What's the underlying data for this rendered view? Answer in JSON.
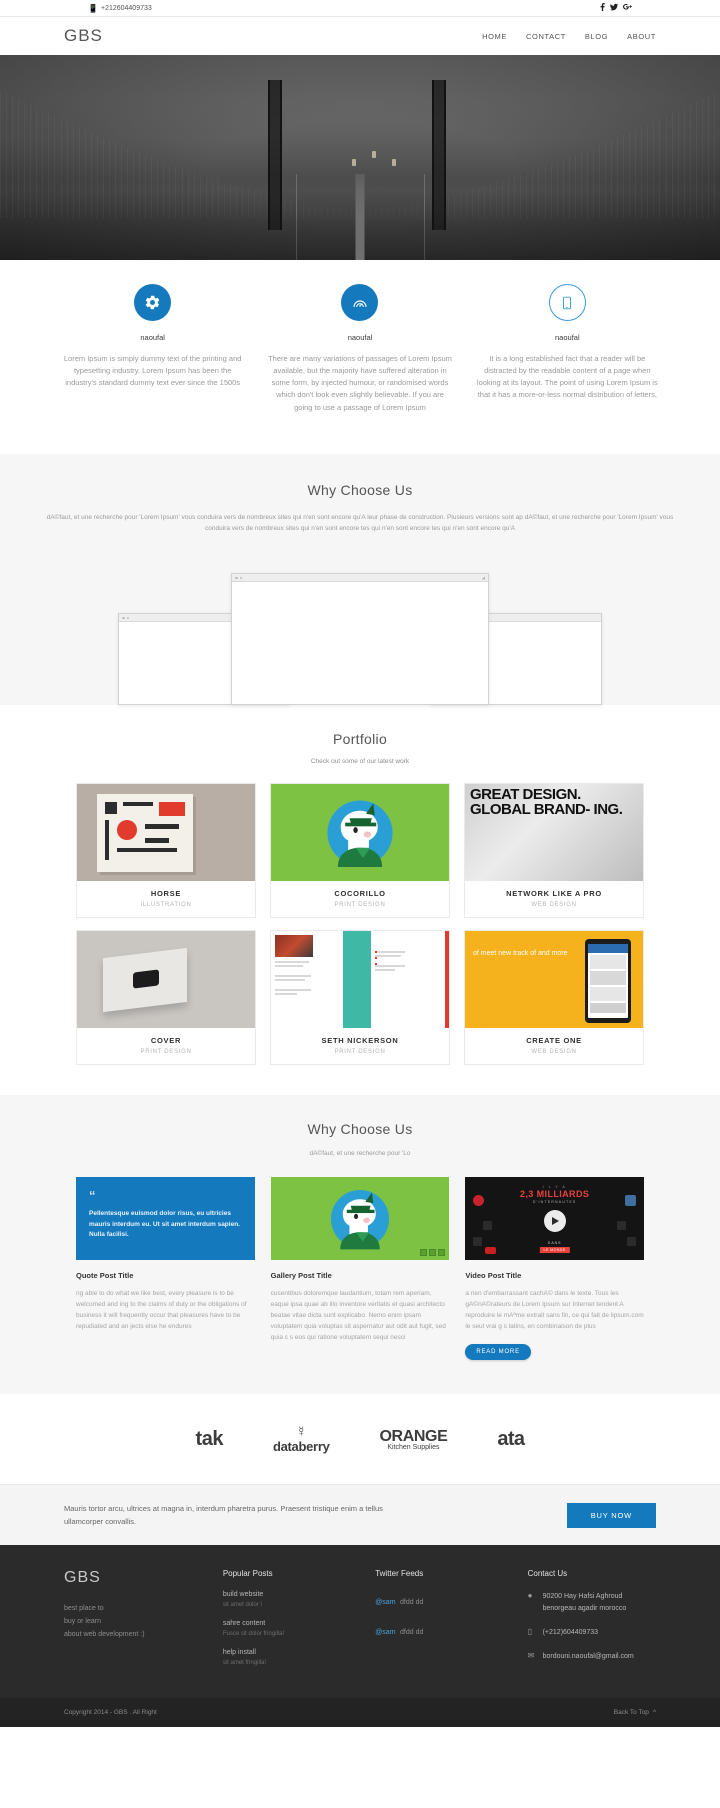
{
  "topbar": {
    "phone": "+212604409733",
    "phone_icon": "mobile-icon",
    "social": [
      {
        "name": "facebook-icon",
        "glyph": "f"
      },
      {
        "name": "twitter-icon",
        "glyph": "ᴠ"
      },
      {
        "name": "google-plus-icon",
        "glyph": "g"
      }
    ]
  },
  "nav": {
    "brand": "GBS",
    "links": [
      "HOME",
      "CONTACT",
      "BLOG",
      "ABOUT"
    ]
  },
  "features": [
    {
      "icon": "gear-icon",
      "title": "naoufal",
      "text": "Lorem Ipsum is simply dummy text of the printing and typesetting industry. Lorem Ipsum has been the industry's standard dummy text ever since the 1500s"
    },
    {
      "icon": "speedometer-icon",
      "title": "naoufal",
      "text": "There are many variations of passages of Lorem Ipsum available, but the majority have suffered alteration in some form, by injected humour, or randomised words which don't look even slightly believable. If you are going to use a passage of Lorem Ipsum"
    },
    {
      "icon": "tablet-icon",
      "title": "naoufal",
      "text": "It is a long established fact that a reader will be distracted by the readable content of a page when looking at its layout. The point of using Lorem Ipsum is that it has a more-or-less normal distribution of letters,"
    }
  ],
  "why_screens": {
    "title": "Why Choose Us",
    "subtitle": "dA©faut, et une recherche pour 'Lorem Ipsum' vous conduira vers de nombreux sites qui n'en sont encore qu'A  leur phase de construction. Plusieurs versions sont ap dA©faut, et une recherche pour 'Lorem Ipsum' vous conduira vers de nombreux sites qui n'en sont encore tes qui n'en sont encore tes qui n'en sont encore qu'A"
  },
  "portfolio": {
    "title": "Portfolio",
    "subtitle": "Check out some of our latest work",
    "items": [
      {
        "name": "HORSE",
        "category": "ILLUSTRATION",
        "art": "horse"
      },
      {
        "name": "COCORILLO",
        "category": "PRINT DESIGN",
        "art": "green"
      },
      {
        "name": "NETWORK LIKE A PRO",
        "category": "WEB DESIGN",
        "art": "bw",
        "art_text": "GREAT DESIGN. GLOBAL BRAND- ING."
      },
      {
        "name": "COVER",
        "category": "PRINT DESIGN",
        "art": "cover"
      },
      {
        "name": "SETH NICKERSON",
        "category": "PRINT DESIGN",
        "art": "web"
      },
      {
        "name": "CREATE ONE",
        "category": "WEB DESIGN",
        "art": "mobile",
        "art_text": "of meet new track of and more"
      }
    ]
  },
  "blog": {
    "title": "Why Choose Us",
    "subtitle": "dA©faut, et une recherche pour 'Lo",
    "posts": [
      {
        "kind": "quote",
        "quote": "Pellentesque euismod dolor risus, eu ultricies mauris interdum eu. Ut sit amet interdum sapien. Nulla facilisi.",
        "title": "Quote Post Title",
        "text": "ng able to do what we like best, every pleasure is to be welcomed and ing to the claims of duty or the obligations of business it will frequently occur that pleasures have to be repudiated and an jects else he endures"
      },
      {
        "kind": "gallery",
        "title": "Gallery Post Title",
        "text": "cusentibus doloremque laudantium, totam rem aperiam, eaque ipsa quae ab illo inventore veritatis et quasi architecto beatae vitae dicta sunt explicabo. Nemo enim ipsam voluptatem quia voluptas sit aspernatur aut odit aut fugit, sed quia c s eos qui ratione voluptatem sequi nesci"
      },
      {
        "kind": "video",
        "title": "Video Post Title",
        "text": "a rien d'embarrassant cachA© dans le texte. Tous les gA©nA©rateurs de Lorem Ipsum sur Internet tendent A  reproduire le mAªme extrait sans fin, ce qui fait de lipsum.com le seul vrai g s latins, en combinaison de plus",
        "button": "READ MORE",
        "video_overlay": {
          "kicker": "I L Y A",
          "headline": "2,3 MILLIARDS",
          "sub": "D'INTERNAUTES",
          "tag": "LE MONDE",
          "tag2": "DANS"
        }
      }
    ]
  },
  "clients": [
    {
      "name": "tak",
      "style": "tak"
    },
    {
      "name": "databerry",
      "style": "databerry"
    },
    {
      "name": "ORANGE",
      "sub": "Kitchen Supplies",
      "style": "orange"
    },
    {
      "name": "ata",
      "style": "ata"
    }
  ],
  "cta": {
    "text": "Mauris tortor arcu, ultrices at magna in, interdum pharetra purus. Praesent tristique enim a tellus ullamcorper convallis.",
    "button": "BUY NOW"
  },
  "footer": {
    "brand": "GBS",
    "tagline": "best place to\nbuy or learn\nabout web development :)",
    "popular_posts": {
      "heading": "Popular Posts",
      "items": [
        {
          "title": "build website",
          "meta": "sit amet dolor l"
        },
        {
          "title": "sahre content",
          "meta": "Fusce sit dolor fringilla!"
        },
        {
          "title": "help install",
          "meta": "sit amet fringilla!"
        }
      ]
    },
    "twitter": {
      "heading": "Twitter Feeds",
      "items": [
        {
          "handle": "@sam",
          "text": "dfdd dd"
        },
        {
          "handle": "@sam",
          "text": "dfdd dd"
        }
      ]
    },
    "contact": {
      "heading": "Contact Us",
      "address": "90200 Hay Hafsi Aghroud\nbenorgeau agadir morocco",
      "phone": "(+212)604409733",
      "email": "bordouni.naoufal@gmail.com",
      "icons": {
        "address": "location-pin-icon",
        "phone": "mobile-icon",
        "email": "envelope-icon"
      }
    }
  },
  "copybar": {
    "copyright": "Copyright 2014 - GBS . All Right",
    "back_to_top": "Back To Top",
    "back_to_top_icon": "chevron-up-icon"
  },
  "colors": {
    "accent": "#1579bd",
    "green": "#7dc242",
    "yellow": "#f5b21d",
    "red": "#e8413a",
    "footer_bg": "#2b2b2b"
  }
}
